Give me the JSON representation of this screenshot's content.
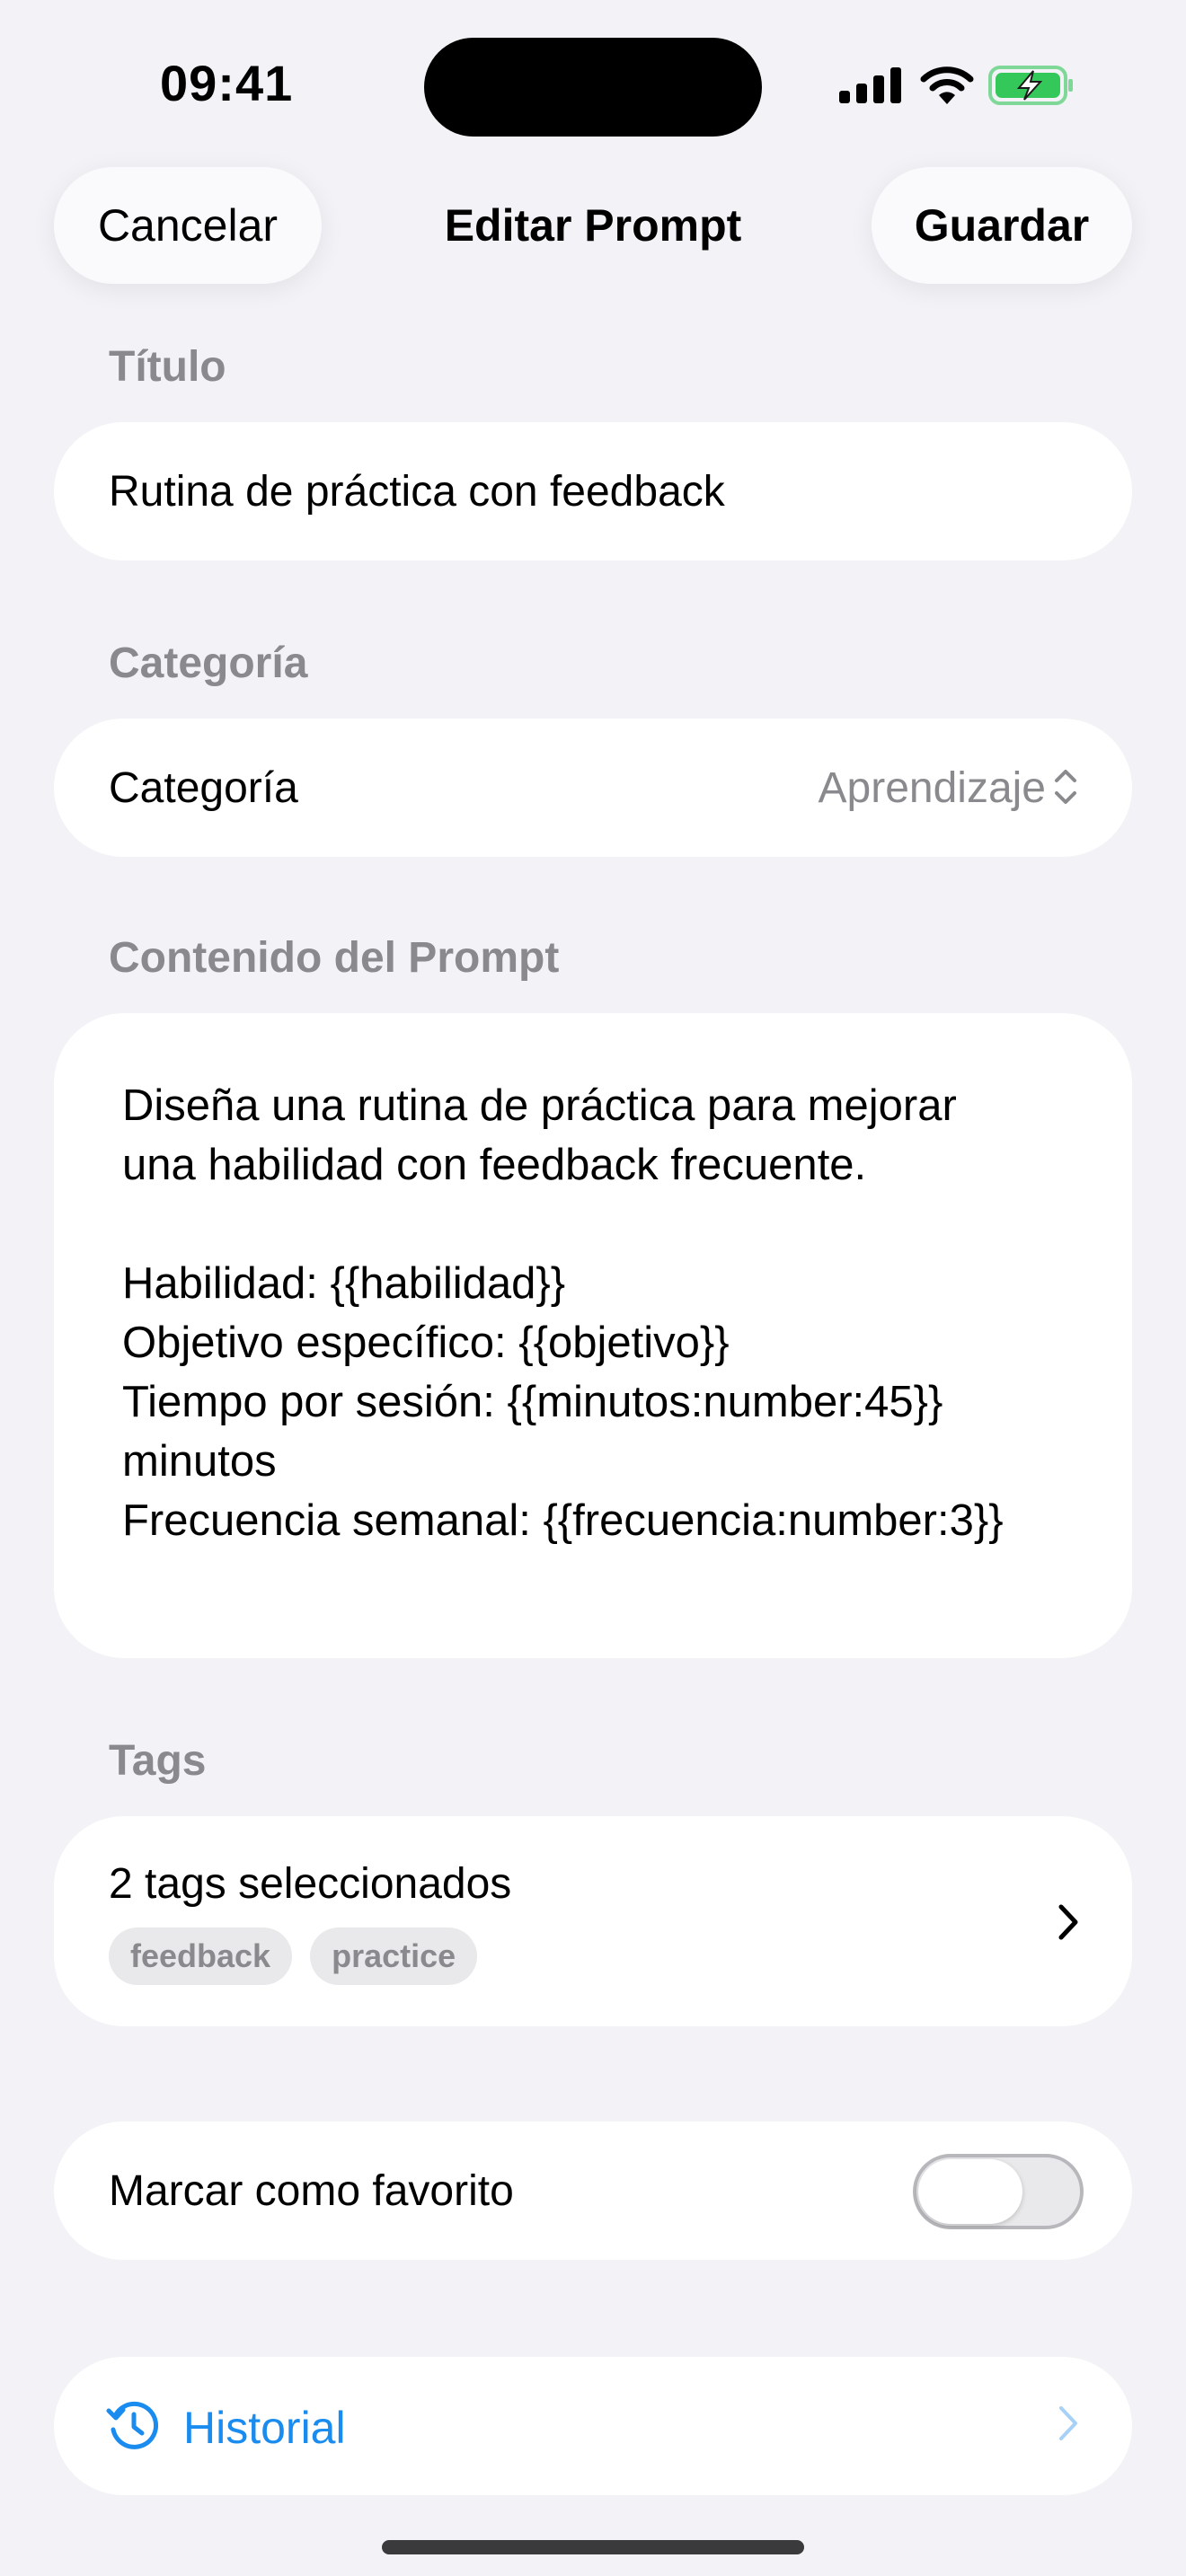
{
  "status_bar": {
    "time": "09:41",
    "icons": [
      "cellular-signal-icon",
      "wifi-icon",
      "battery-charging-icon"
    ]
  },
  "nav": {
    "cancel_label": "Cancelar",
    "title": "Editar Prompt",
    "save_label": "Guardar"
  },
  "sections": {
    "title_label": "Título",
    "category_label": "Categoría",
    "content_label": "Contenido del Prompt",
    "tags_label": "Tags"
  },
  "form": {
    "title_value": "Rutina de práctica con feedback",
    "category_row_label": "Categoría",
    "category_value": "Aprendizaje",
    "content": "Diseña una rutina de práctica para mejorar\nuna habilidad con feedback frecuente.\n\nHabilidad: {{habilidad}}\nObjetivo específico: {{objetivo}}\nTiempo por sesión: {{minutos:number:45}}\nminutos\nFrecuencia semanal: {{frecuencia:number:3}}",
    "tags_summary": "2 tags seleccionados",
    "tags": [
      "feedback",
      "practice"
    ],
    "favorite_label": "Marcar como favorito",
    "favorite_on": false,
    "history_label": "Historial"
  },
  "colors": {
    "background": "#F2F2F7",
    "accent": "#1A8CEF",
    "secondary_text": "#8A8A8E",
    "battery": "#34C759"
  }
}
